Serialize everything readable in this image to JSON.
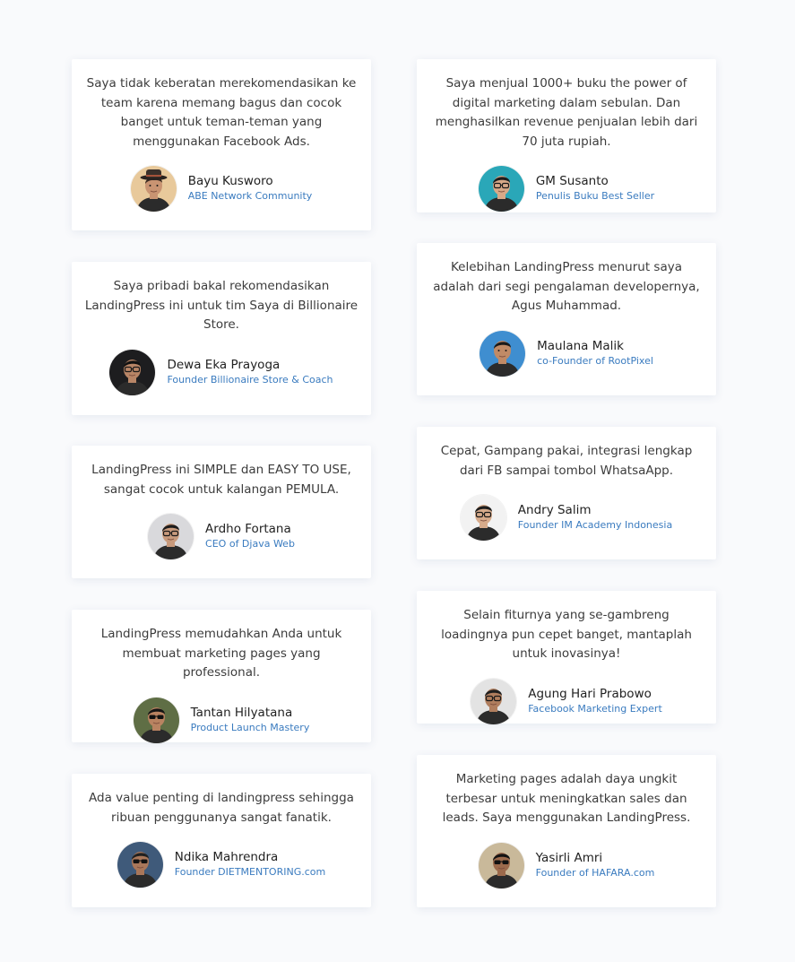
{
  "colors": {
    "background": "#f9fafc",
    "card": "#ffffff",
    "quote_text": "#3c3c3c",
    "name_text": "#222222",
    "title_text": "#3a7bbf"
  },
  "testimonials": [
    {
      "quote": "Saya tidak keberatan merekomendasikan ke team karena memang bagus dan cocok banget untuk teman-teman yang menggunakan Facebook Ads.",
      "name": "Bayu Kusworo",
      "title": "ABE Network Community",
      "avatar_icon": "man-with-hat-avatar"
    },
    {
      "quote": "Saya menjual 1000+ buku the power of digital marketing dalam sebulan. Dan menghasilkan revenue penjualan lebih dari 70 juta rupiah.",
      "name": "GM Susanto",
      "title": "Penulis Buku Best Seller",
      "avatar_icon": "man-glasses-avatar"
    },
    {
      "quote": "Saya pribadi bakal rekomendasikan LandingPress ini untuk tim Saya di Billionaire Store.",
      "name": "Dewa Eka Prayoga",
      "title": "Founder Billionaire Store & Coach",
      "avatar_icon": "man-glasses-avatar"
    },
    {
      "quote": "Kelebihan LandingPress menurut saya adalah dari segi pengalaman developernya, Agus Muhammad.",
      "name": "Maulana Malik",
      "title": "co-Founder of RootPixel",
      "avatar_icon": "man-avatar"
    },
    {
      "quote": "LandingPress ini SIMPLE dan EASY TO USE, sangat cocok untuk kalangan PEMULA.",
      "name": "Ardho Fortana",
      "title": "CEO of Djava Web",
      "avatar_icon": "man-glasses-avatar"
    },
    {
      "quote": "Cepat, Gampang pakai, integrasi lengkap dari FB sampai tombol WhatsaApp.",
      "name": "Andry Salim",
      "title": "Founder IM Academy Indonesia",
      "avatar_icon": "man-glasses-avatar"
    },
    {
      "quote": "LandingPress memudahkan Anda untuk membuat marketing pages yang professional.",
      "name": "Tantan Hilyatana",
      "title": "Product Launch Mastery",
      "avatar_icon": "man-sunglasses-avatar"
    },
    {
      "quote": "Selain fiturnya yang se-gambreng loadingnya pun cepet banget, mantaplah untuk inovasinya!",
      "name": "Agung Hari Prabowo",
      "title": "Facebook Marketing Expert",
      "avatar_icon": "man-glasses-avatar"
    },
    {
      "quote": "Ada value penting di landingpress sehingga ribuan penggunanya sangat fanatik.",
      "name": "Ndika Mahrendra",
      "title": "Founder DIETMENTORING.com",
      "avatar_icon": "man-sunglasses-avatar"
    },
    {
      "quote": "Marketing pages adalah daya ungkit terbesar untuk meningkatkan sales dan leads. Saya menggunakan LandingPress.",
      "name": "Yasirli Amri",
      "title": "Founder of HAFARA.com",
      "avatar_icon": "man-sunglasses-avatar"
    }
  ]
}
